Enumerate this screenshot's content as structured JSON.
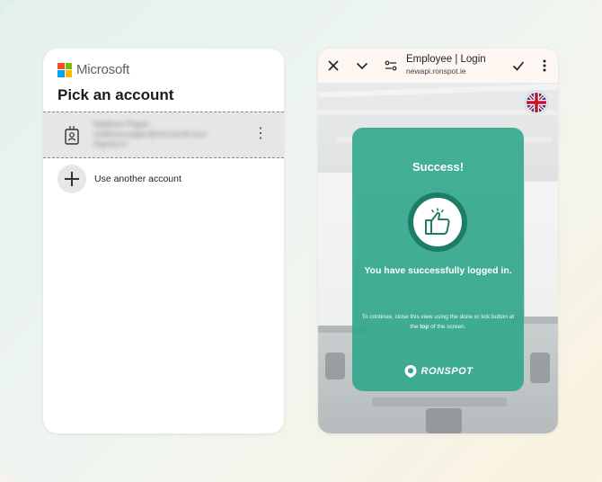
{
  "microsoft": {
    "brand": "Microsoft",
    "logo_colors": [
      "#f25022",
      "#7fba00",
      "#00a4ef",
      "#ffb900"
    ],
    "title": "Pick an account",
    "account": {
      "name": "Matthew Pagan",
      "email": "matthew.pagan@microsoft.com",
      "status": "Signed in",
      "icon": "badge-icon",
      "more_icon": "⋮"
    },
    "use_another_label": "Use another account"
  },
  "browser": {
    "title": "Employee | Login",
    "url": "newapi.ronspot.ie",
    "icons": [
      "close-icon",
      "chevron-down-icon",
      "site-settings-icon",
      "check-icon",
      "more-vertical-icon"
    ]
  },
  "card": {
    "title": "Success!",
    "message": "You have successfully logged in.",
    "note_before": "To continue, close this view using the done or tick button at the ",
    "note_bold": "top",
    "note_after": " of the screen.",
    "brand": "RONSPOT",
    "accent": "#2ba68a"
  }
}
